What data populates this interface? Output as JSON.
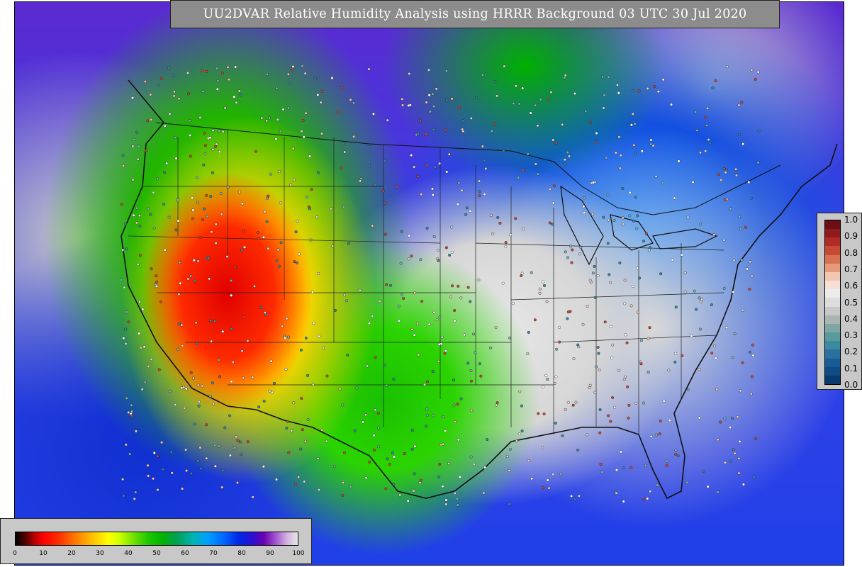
{
  "title": "UU2DVAR Relative Humidity Analysis using HRRR Background 03 UTC 30 Jul 2020",
  "rh_colorbar": {
    "ticks": [
      "0",
      "10",
      "20",
      "30",
      "40",
      "50",
      "60",
      "70",
      "80",
      "90",
      "100"
    ]
  },
  "ratio_colorbar": {
    "ticks": [
      "1.0",
      "0.9",
      "0.8",
      "0.7",
      "0.6",
      "0.5",
      "0.4",
      "0.3",
      "0.2",
      "0.1",
      "0.0"
    ],
    "colors_top_to_bottom": [
      "#6b0f16",
      "#8e1a1e",
      "#b02a26",
      "#c94a34",
      "#d87052",
      "#e69a7c",
      "#f3c6b0",
      "#f6e0d6",
      "#ececec",
      "#dddddd",
      "#c8c8c8",
      "#aab4b4",
      "#7ea7a4",
      "#5a9a9c",
      "#3c8aa0",
      "#2a70a0",
      "#1a5a95",
      "#0e4b84",
      "#083a70"
    ]
  }
}
